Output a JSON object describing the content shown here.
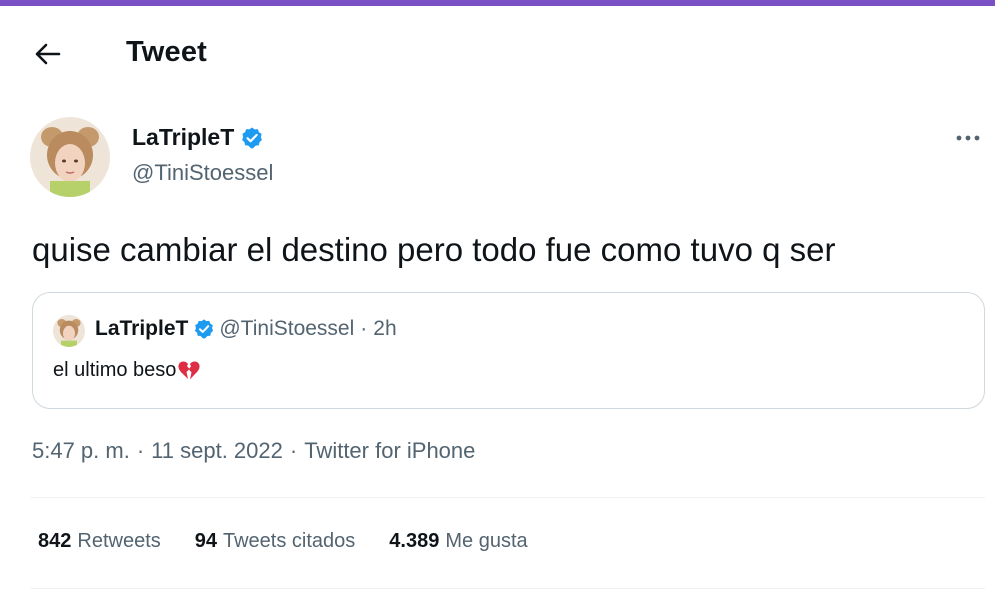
{
  "header": {
    "title": "Tweet",
    "back_icon": "arrow-left-icon"
  },
  "colors": {
    "accent_strip": "#7b50c4",
    "verified": "#1d9bf0",
    "text": "#0f1419",
    "secondary": "#536471"
  },
  "author": {
    "name": "LaTripleT",
    "handle": "@TiniStoessel",
    "verified_icon": "verified-badge-icon"
  },
  "tweet": {
    "text": "quise cambiar el destino pero todo fue como tuvo q ser"
  },
  "quoted": {
    "name": "LaTripleT",
    "handle": "@TiniStoessel",
    "separator": "·",
    "time": "2h",
    "text": "el ultimo beso",
    "emoji_icon": "broken-heart-icon"
  },
  "meta": {
    "time": "5:47 p. m.",
    "separator": "·",
    "date": "11 sept. 2022",
    "source": "Twitter for iPhone"
  },
  "stats": [
    {
      "count": "842",
      "label": "Retweets"
    },
    {
      "count": "94",
      "label": "Tweets citados"
    },
    {
      "count": "4.389",
      "label": "Me gusta"
    }
  ]
}
